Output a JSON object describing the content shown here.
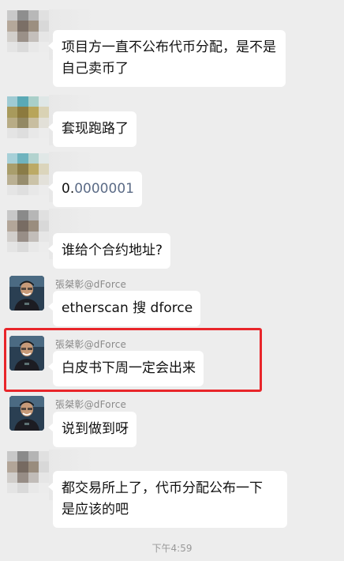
{
  "messages": [
    {
      "sender": "",
      "text": "项目方一直不公布代币分配，是不是自己卖币了"
    },
    {
      "sender": "",
      "text": "套现跑路了"
    },
    {
      "sender": "",
      "text_prefix": "0.",
      "text_link": "0000001"
    },
    {
      "sender": "",
      "text": "谁给个合约地址?"
    },
    {
      "sender": "張桀彰@dForce",
      "text": "etherscan 搜 dforce"
    },
    {
      "sender": "張桀彰@dForce",
      "text": "白皮书下周一定会出来"
    },
    {
      "sender": "張桀彰@dForce",
      "text": "说到做到呀"
    },
    {
      "sender": "",
      "text_line1": "都交易所上了，代币分配公布一下",
      "text_line2": "是应该的吧"
    }
  ],
  "timestamp": "下午4:59",
  "colors": {
    "background": "#ededed",
    "bubble": "#ffffff",
    "highlight": "#e8252a",
    "link": "#5b6b86"
  },
  "icons": [
    "pixelated-avatar",
    "user-photo-avatar"
  ]
}
